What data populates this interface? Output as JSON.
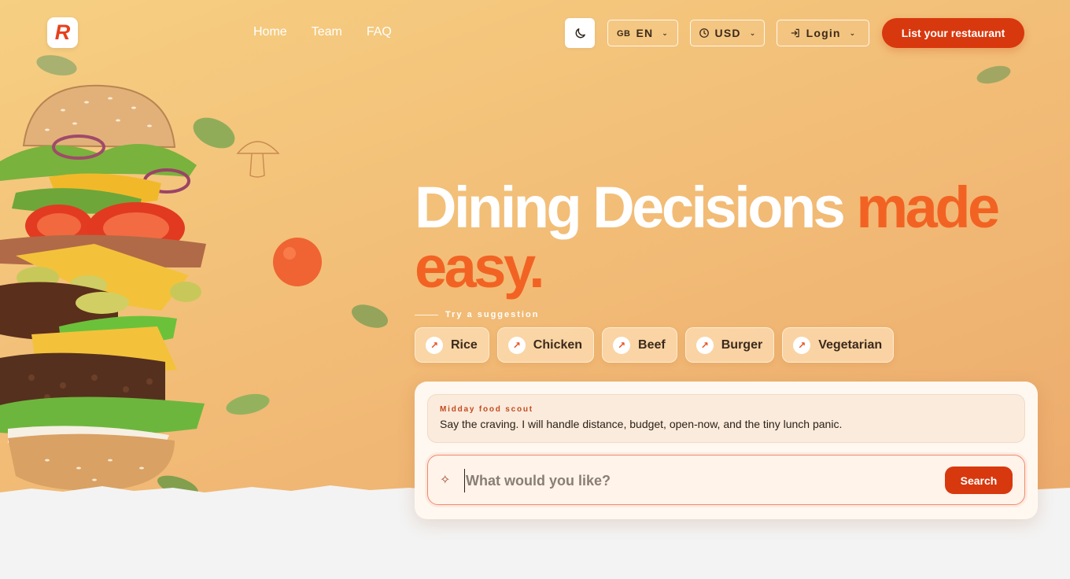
{
  "header": {
    "logo_letter": "R",
    "nav": [
      "Home",
      "Team",
      "FAQ"
    ],
    "language": {
      "flag": "GB",
      "code": "EN"
    },
    "currency": "USD",
    "login_label": "Login",
    "cta_label": "List your restaurant"
  },
  "hero": {
    "title_main": "Dining Decisions ",
    "title_accent": "made easy.",
    "suggestion_label": "Try a suggestion",
    "suggestions": [
      "Rice",
      "Chicken",
      "Beef",
      "Burger",
      "Vegetarian"
    ]
  },
  "search": {
    "scout_title": "Midday food scout",
    "scout_message": "Say the craving. I will handle distance, budget, open-now, and the tiny lunch panic.",
    "placeholder": "What would you like?",
    "button_label": "Search"
  },
  "icons": {
    "theme": "moon-icon",
    "currency": "clock-icon",
    "login": "login-arrow-icon",
    "dropdown": "chevron-down-icon",
    "suggestion": "arrow-up-right-icon",
    "search": "sparkle-icon"
  },
  "colors": {
    "accent": "#d8380e",
    "accent_text": "#f26323",
    "background": "#f2bd77"
  }
}
